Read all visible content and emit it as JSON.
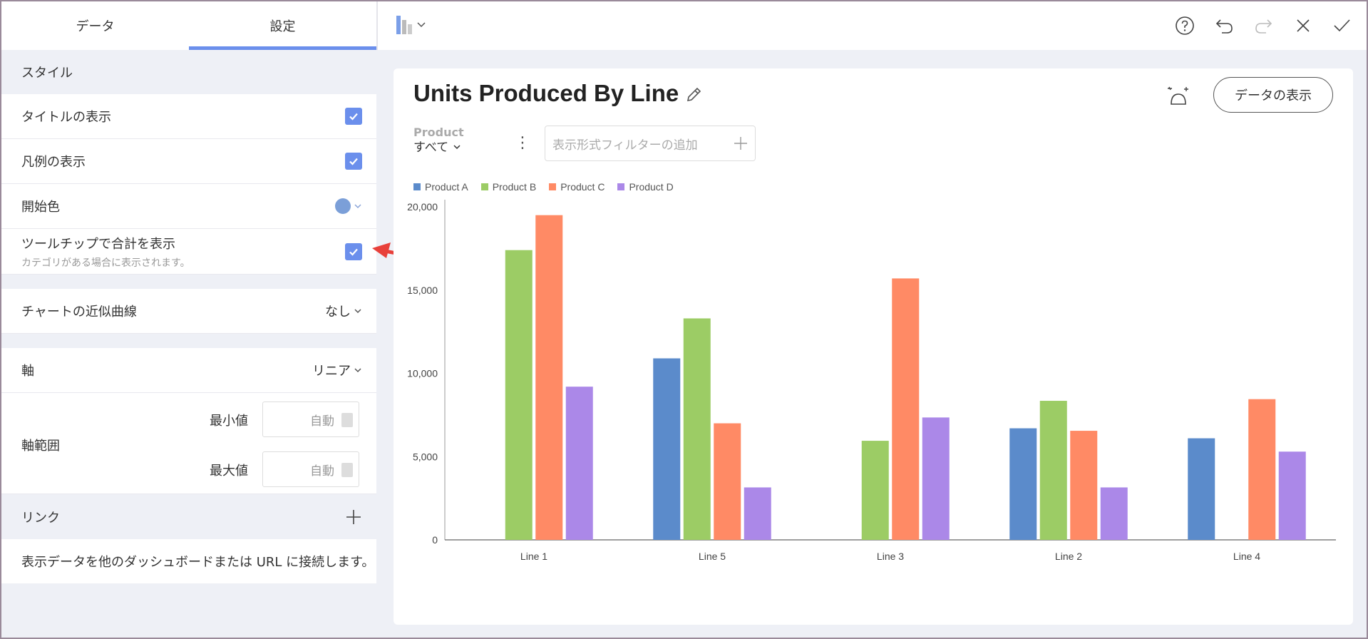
{
  "tabs": [
    {
      "label": "データ"
    },
    {
      "label": "設定"
    }
  ],
  "settings": {
    "style_heading": "スタイル",
    "show_title": "タイトルの表示",
    "show_legend": "凡例の表示",
    "start_color": "開始色",
    "start_color_value": "#7b9fd8",
    "tooltip_total": "ツールチップで合計を表示",
    "tooltip_total_sub": "カテゴリがある場合に表示されます。",
    "trendline": "チャートの近似曲線",
    "trendline_value": "なし",
    "axis": "軸",
    "axis_value": "リニア",
    "axis_range": "軸範囲",
    "min_label": "最小値",
    "min_value": "自動",
    "max_label": "最大値",
    "max_value": "自動",
    "link_heading": "リンク",
    "link_desc": "表示データを他のダッシュボードまたは URL に接続します。"
  },
  "card": {
    "title": "Units Produced By Line",
    "view_data_button": "データの表示",
    "filter_label": "Product",
    "filter_value": "すべて",
    "add_filter_placeholder": "表示形式フィルターの追加"
  },
  "chart_data": {
    "type": "bar",
    "categories": [
      "Line 1",
      "Line 5",
      "Line 3",
      "Line 2",
      "Line 4"
    ],
    "series": [
      {
        "name": "Product A",
        "color": "#5b8bcb",
        "values": [
          0,
          10900,
          0,
          6700,
          6100
        ]
      },
      {
        "name": "Product B",
        "color": "#9ccc65",
        "values": [
          17400,
          13300,
          5950,
          8350,
          0
        ]
      },
      {
        "name": "Product C",
        "color": "#ff8a65",
        "values": [
          19500,
          7000,
          15700,
          6550,
          8450
        ]
      },
      {
        "name": "Product D",
        "color": "#ab88e8",
        "values": [
          9200,
          3150,
          7350,
          3150,
          5300
        ]
      }
    ],
    "ylim": [
      0,
      20000
    ],
    "yticks": [
      "0",
      "5,000",
      "10,000",
      "15,000",
      "20,000"
    ],
    "ytick_values": [
      0,
      5000,
      10000,
      15000,
      20000
    ],
    "legend_position": "top-left",
    "grid": false
  }
}
